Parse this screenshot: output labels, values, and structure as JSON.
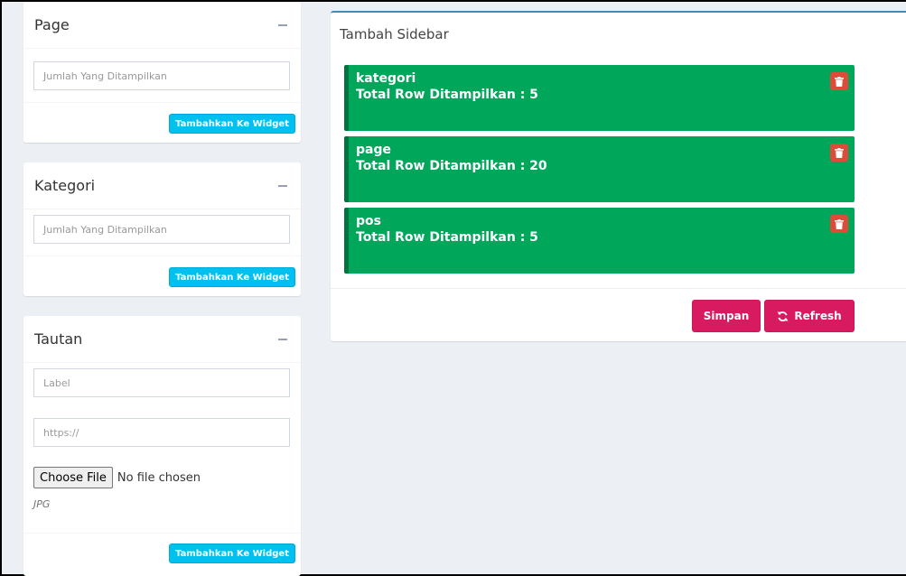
{
  "page_box": {
    "title": "Page",
    "input_placeholder": "Jumlah Yang Ditampilkan",
    "button_label": "Tambahkan Ke Widget"
  },
  "kategori_box": {
    "title": "Kategori",
    "input_placeholder": "Jumlah Yang Ditampilkan",
    "button_label": "Tambahkan Ke Widget"
  },
  "tautan_box": {
    "title": "Tautan",
    "label_placeholder": "Label",
    "url_placeholder": "https://",
    "file_button": "Choose File",
    "file_status": "No file chosen",
    "file_hint": "JPG",
    "button_label": "Tambahkan Ke Widget"
  },
  "sidebar": {
    "title": "Tambah Sidebar",
    "items": [
      {
        "name": "kategori",
        "detail": "Total Row Ditampilkan : 5"
      },
      {
        "name": "page",
        "detail": "Total Row Ditampilkan : 20"
      },
      {
        "name": "pos",
        "detail": "Total Row Ditampilkan : 5"
      }
    ],
    "save_label": "Simpan",
    "refresh_label": "Refresh"
  },
  "colors": {
    "item_green": "#00a65a",
    "delete_red": "#dd4b39",
    "action_maroon": "#d81b60",
    "widget_button": "#00c0ef"
  }
}
